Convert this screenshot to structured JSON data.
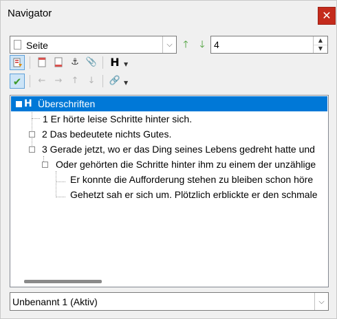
{
  "window": {
    "title": "Navigator",
    "close_glyph": "✕"
  },
  "nav_combo": {
    "value": "Seite",
    "chevron": "⌵"
  },
  "page_nav": {
    "up_arrow": "🡑",
    "down_arrow": "🡓",
    "page_number": "4",
    "spin_up": "▲",
    "spin_down": "▼"
  },
  "toolbar1": {
    "heading_glyph": "H",
    "anchor_glyph": "⚓",
    "clip_glyph": "📎",
    "caret": "▼"
  },
  "toolbar2": {
    "check_glyph": "✔",
    "left_glyph": "←",
    "right_glyph": "→",
    "up_glyph": "↑",
    "down_glyph": "↓",
    "link_glyph": "🔗",
    "caret": "▼"
  },
  "tree": {
    "root": {
      "label": "Überschriften",
      "icon_glyph": "H"
    },
    "items": [
      {
        "label": "1 Er hörte leise Schritte hinter sich."
      },
      {
        "label": "2 Das bedeutete nichts Gutes."
      },
      {
        "label": "3 Gerade jetzt, wo er das Ding seines Lebens gedreht hatte und"
      },
      {
        "label": "Oder gehörten die Schritte hinter ihm zu einem der unzählige"
      },
      {
        "label": "Er konnte die Aufforderung stehen zu bleiben schon höre"
      },
      {
        "label": "Gehetzt sah er sich um. Plötzlich erblickte er den schmale"
      }
    ]
  },
  "document_combo": {
    "value": "Unbenannt 1 (Aktiv)",
    "chevron": "⌵"
  }
}
